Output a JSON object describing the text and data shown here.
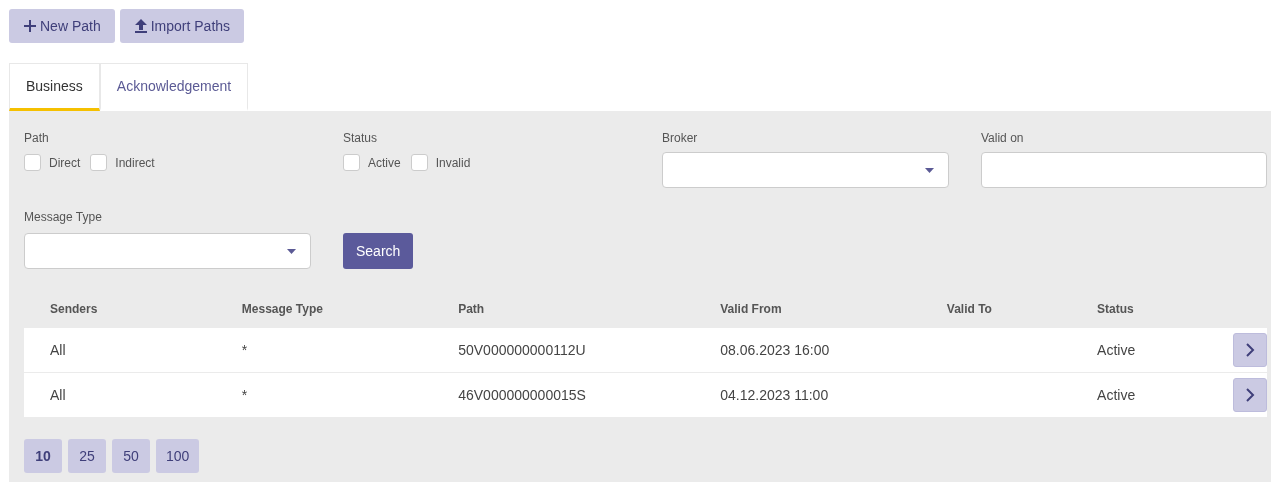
{
  "actions": [
    {
      "kind": "plus",
      "label": "New Path"
    },
    {
      "kind": "upload",
      "label": "Import Paths"
    }
  ],
  "tabs": [
    {
      "label": "Business",
      "selected": true
    },
    {
      "label": "Acknowledgement",
      "selected": false
    }
  ],
  "filters": {
    "path": {
      "label": "Path",
      "options": [
        {
          "label": "Direct",
          "checked": false
        },
        {
          "label": "Indirect",
          "checked": false
        }
      ]
    },
    "status": {
      "label": "Status",
      "options": [
        {
          "label": "Active",
          "checked": false
        },
        {
          "label": "Invalid",
          "checked": false
        }
      ]
    },
    "broker": {
      "label": "Broker"
    },
    "valid_on": {
      "label": "Valid on"
    },
    "message_type": {
      "label": "Message Type"
    },
    "search_button": "Search"
  },
  "table": {
    "columns": [
      "Senders",
      "Message Type",
      "Path",
      "Valid From",
      "Valid To",
      "Status"
    ],
    "rows": [
      {
        "cells": [
          "All",
          "*",
          "50V000000000112U",
          "08.06.2023 16:00",
          "",
          "Active"
        ]
      },
      {
        "cells": [
          "All",
          "*",
          "46V000000000015S",
          "04.12.2023 11:00",
          "",
          "Active"
        ]
      }
    ]
  },
  "page_sizes": [
    {
      "label": "10",
      "selected": true
    },
    {
      "label": "25",
      "selected": false
    },
    {
      "label": "50",
      "selected": false
    },
    {
      "label": "100",
      "selected": false
    }
  ]
}
